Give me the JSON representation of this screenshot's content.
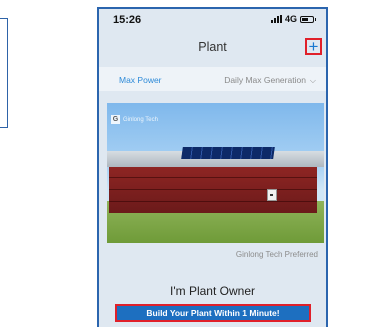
{
  "status_bar": {
    "time": "15:26",
    "network": "4G",
    "battery_level": 0.6
  },
  "nav": {
    "title": "Plant",
    "add_icon": "plus-icon",
    "add_symbol": "+"
  },
  "tabs": {
    "left_label": "Max Power",
    "right_label": "Daily Max Generation",
    "chevron": "⌵"
  },
  "banner": {
    "watermark_logo_text": "Ginlong Tech",
    "caption": "Ginlong Tech Preferred"
  },
  "owner": {
    "heading": "I'm Plant Owner",
    "build_button_label": "Build Your Plant Within 1 Minute!"
  },
  "colors": {
    "accent_blue": "#1d6fc0",
    "highlight_red": "#e0202a",
    "tab_active": "#2d8ad8"
  }
}
